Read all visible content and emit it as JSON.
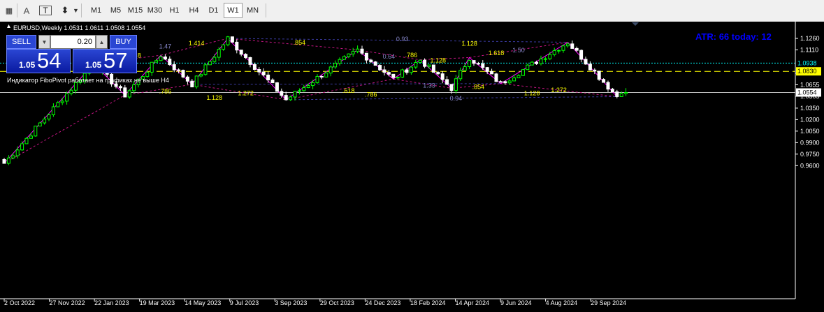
{
  "toolbar": {
    "tools": [
      {
        "name": "period-separator-icon",
        "glyph": "▦"
      },
      {
        "name": "text-tool-icon",
        "glyph": "A"
      },
      {
        "name": "text-label-tool-icon",
        "glyph": "T"
      },
      {
        "name": "arrows-tool-icon",
        "glyph": "⬍"
      }
    ],
    "timeframes": [
      "M1",
      "M5",
      "M15",
      "M30",
      "H1",
      "H4",
      "D1",
      "W1",
      "MN"
    ],
    "active_timeframe": "W1"
  },
  "chart": {
    "header": "EURUSD,Weekly  1.0531 1.0611 1.0508 1.0554",
    "atr_text": "ATR: 66  today: 12",
    "notice": "Индикатор FiboPivot работает на графиках не выше H4",
    "trade_panel": {
      "sell_label": "SELL",
      "buy_label": "BUY",
      "lot_value": "0.20",
      "bid_small": "1.05",
      "bid_big": "54",
      "ask_small": "1.05",
      "ask_big": "57"
    },
    "colors": {
      "background": "#000000",
      "axis_text": "#ffffff",
      "bull_candle": "#00ff00",
      "bear_candle": "#ffffff",
      "zigzag": "#ff00ff",
      "fibo_dashed": "#c71585",
      "level_cyan": "#00ffff",
      "level_yellow": "#ffff00",
      "atr_text": "#0000ff",
      "panel_blue": "#2a46d3"
    }
  },
  "chart_data": {
    "type": "candlestick",
    "symbol": "EURUSD",
    "timeframe": "Weekly",
    "ohlc": {
      "open": 1.0531,
      "high": 1.0611,
      "low": 1.0508,
      "close": 1.0554
    },
    "ylim": [
      0.959,
      1.233
    ],
    "y_ticks": [
      "1.1260",
      "1.1110",
      "1.0805",
      "1.0655",
      "1.0505",
      "1.0350",
      "1.0200",
      "1.0050",
      "0.9900",
      "0.9750",
      "0.9600"
    ],
    "x_ticks": [
      "2 Oct 2022",
      "27 Nov 2022",
      "22 Jan 2023",
      "19 Mar 2023",
      "14 May 2023",
      "9 Jul 2023",
      "3 Sep 2023",
      "29 Oct 2023",
      "24 Dec 2023",
      "18 Feb 2024",
      "14 Apr 2024",
      "9 Jun 2024",
      "4 Aug 2024",
      "29 Sep 2024"
    ],
    "price_labels": [
      {
        "value": "1.0938",
        "price": 1.0938,
        "style": "cyan"
      },
      {
        "value": "1.0830",
        "price": 1.083,
        "style": "yellow"
      },
      {
        "value": "1.0554",
        "price": 1.0554,
        "style": "white"
      }
    ],
    "levels": [
      {
        "price": 1.0938,
        "style": "dotted",
        "color": "#00ffff"
      },
      {
        "price": 1.083,
        "style": "dashed",
        "color": "#ffff00"
      },
      {
        "price": 1.0554,
        "style": "solid",
        "color": "#c0c0c0"
      }
    ],
    "zigzag": [
      {
        "i": 0,
        "p": 0.963
      },
      {
        "i": 20,
        "p": 1.093
      },
      {
        "i": 27,
        "p": 1.052
      },
      {
        "i": 35,
        "p": 1.104
      },
      {
        "i": 42,
        "p": 1.066
      },
      {
        "i": 50,
        "p": 1.126
      },
      {
        "i": 63,
        "p": 1.046
      },
      {
        "i": 79,
        "p": 1.111
      },
      {
        "i": 87,
        "p": 1.073
      },
      {
        "i": 93,
        "p": 1.098
      },
      {
        "i": 100,
        "p": 1.061
      },
      {
        "i": 104,
        "p": 1.101
      },
      {
        "i": 111,
        "p": 1.067
      },
      {
        "i": 126,
        "p": 1.121
      },
      {
        "i": 137,
        "p": 1.05
      }
    ],
    "fib_labels": [
      {
        "text": "1.414",
        "i": 43,
        "p": 1.117,
        "color": "#ffff00"
      },
      {
        "text": "1.47",
        "i": 36,
        "p": 1.113,
        "color": "#8888cc"
      },
      {
        "text": ".8",
        "i": 30,
        "p": 1.101,
        "color": "#ffff00"
      },
      {
        "text": ".854",
        "i": 66,
        "p": 1.118,
        "color": "#ffff00"
      },
      {
        "text": "0.93",
        "i": 89,
        "p": 1.1225,
        "color": "#8888cc"
      },
      {
        "text": "1.128",
        "i": 104,
        "p": 1.1165,
        "color": "#ffff00"
      },
      {
        "text": "0.64",
        "i": 86,
        "p": 1.0995,
        "color": "#8888cc"
      },
      {
        "text": ".786",
        "i": 91,
        "p": 1.1015,
        "color": "#ffff00"
      },
      {
        "text": "1.128",
        "i": 97,
        "p": 1.0945,
        "color": "#ffff00"
      },
      {
        "text": "1.618",
        "i": 110,
        "p": 1.104,
        "color": "#ffff00"
      },
      {
        "text": "1.50",
        "i": 115,
        "p": 1.108,
        "color": "#8888cc"
      },
      {
        "text": ".786",
        "i": 36,
        "p": 1.054,
        "color": "#ffff00"
      },
      {
        "text": "1.272",
        "i": 54,
        "p": 1.052,
        "color": "#ffff00"
      },
      {
        "text": "1.128",
        "i": 47,
        "p": 1.046,
        "color": "#ffff00"
      },
      {
        "text": ".618",
        "i": 77,
        "p": 1.055,
        "color": "#ffff00"
      },
      {
        "text": ".786",
        "i": 82,
        "p": 1.05,
        "color": "#ffff00"
      },
      {
        "text": "1.33",
        "i": 95,
        "p": 1.062,
        "color": "#8888cc"
      },
      {
        "text": ".854",
        "i": 106,
        "p": 1.06,
        "color": "#ffff00"
      },
      {
        "text": "1.272",
        "i": 124,
        "p": 1.056,
        "color": "#ffff00"
      },
      {
        "text": "1.128",
        "i": 118,
        "p": 1.052,
        "color": "#ffff00"
      },
      {
        "text": "0.94",
        "i": 101,
        "p": 1.045,
        "color": "#8888cc"
      }
    ]
  }
}
